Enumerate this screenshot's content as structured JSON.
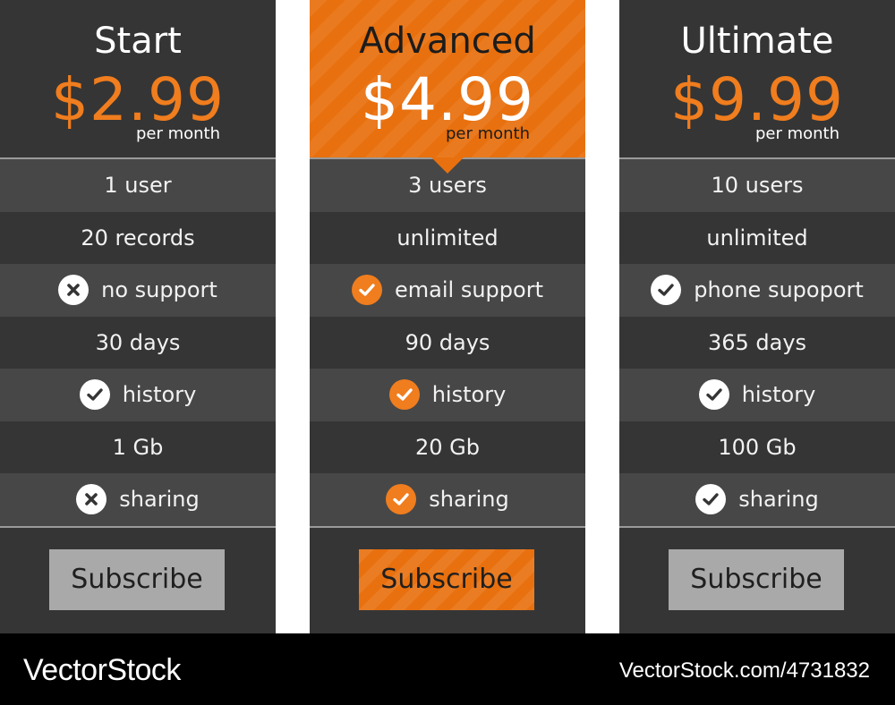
{
  "colors": {
    "accent": "#f07d1e",
    "panel": "#353535",
    "row_light": "#474747",
    "button": "#a9a9a9",
    "footer": "#000000"
  },
  "plans": [
    {
      "name": "Start",
      "price": "$2.99",
      "period": "per month",
      "featured": false,
      "features": [
        {
          "text": "1 user",
          "icon": null
        },
        {
          "text": "20 records",
          "icon": null
        },
        {
          "text": "no support",
          "icon": "cross-icon"
        },
        {
          "text": "30 days",
          "icon": null
        },
        {
          "text": "history",
          "icon": "check-icon"
        },
        {
          "text": "1 Gb",
          "icon": null
        },
        {
          "text": "sharing",
          "icon": "cross-icon"
        }
      ],
      "button": "Subscribe"
    },
    {
      "name": "Advanced",
      "price": "$4.99",
      "period": "per month",
      "featured": true,
      "features": [
        {
          "text": "3 users",
          "icon": null
        },
        {
          "text": "unlimited",
          "icon": null
        },
        {
          "text": "email support",
          "icon": "check-icon"
        },
        {
          "text": "90 days",
          "icon": null
        },
        {
          "text": "history",
          "icon": "check-icon"
        },
        {
          "text": "20 Gb",
          "icon": null
        },
        {
          "text": "sharing",
          "icon": "check-icon"
        }
      ],
      "button": "Subscribe"
    },
    {
      "name": "Ultimate",
      "price": "$9.99",
      "period": "per month",
      "featured": false,
      "features": [
        {
          "text": "10 users",
          "icon": null
        },
        {
          "text": "unlimited",
          "icon": null
        },
        {
          "text": "phone supoport",
          "icon": "check-icon"
        },
        {
          "text": "365 days",
          "icon": null
        },
        {
          "text": "history",
          "icon": "check-icon"
        },
        {
          "text": "100 Gb",
          "icon": null
        },
        {
          "text": "sharing",
          "icon": "check-icon"
        }
      ],
      "button": "Subscribe"
    }
  ],
  "watermark": {
    "logo": "VectorStock",
    "url": "VectorStock.com/4731832"
  }
}
